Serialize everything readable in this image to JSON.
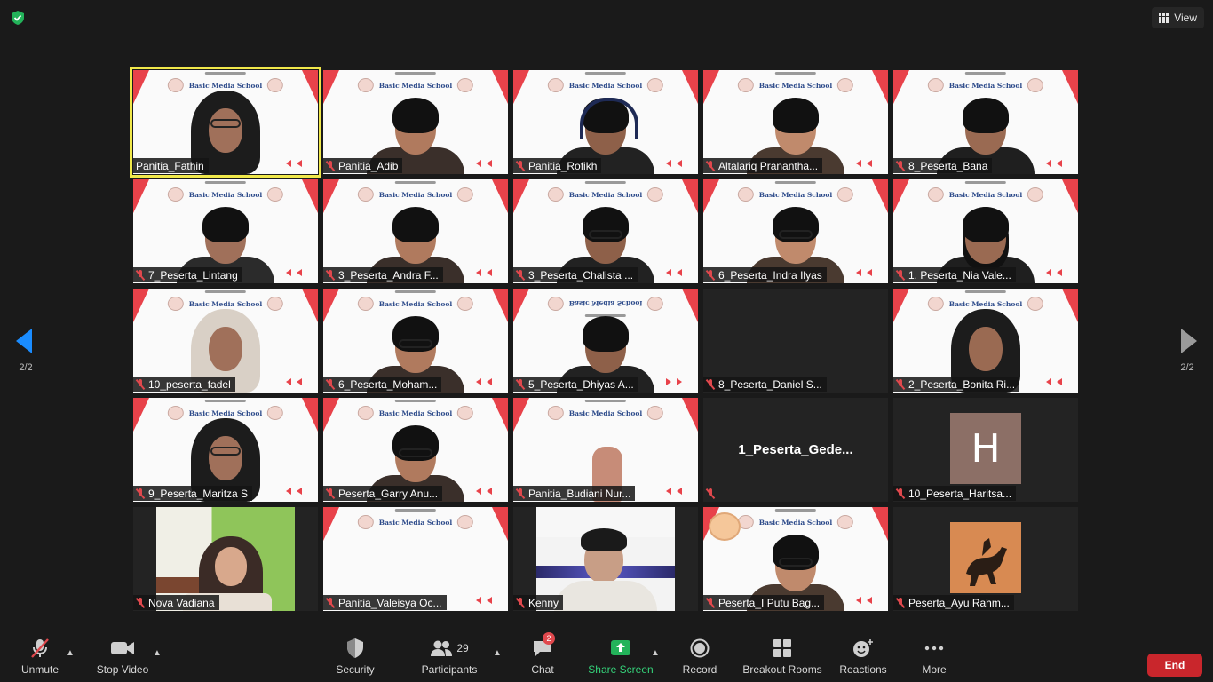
{
  "topbar": {
    "view_label": "View"
  },
  "pagination": {
    "left_page": "2/2",
    "right_page": "2/2"
  },
  "slide_text": "Basic Media School",
  "participants": [
    {
      "name": "Panitia_Fathin",
      "muted": false,
      "kind": "video",
      "active": true,
      "look": "hijab"
    },
    {
      "name": "Panitia_Adib",
      "muted": true,
      "kind": "video",
      "look": "man"
    },
    {
      "name": "Panitia_Rofikh",
      "muted": true,
      "kind": "video",
      "look": "headset"
    },
    {
      "name": "Altalariq Pranantha...",
      "muted": true,
      "kind": "video",
      "look": "man"
    },
    {
      "name": "8_Peserta_Bana",
      "muted": true,
      "kind": "video",
      "look": "man"
    },
    {
      "name": "7_Peserta_Lintang",
      "muted": true,
      "kind": "video",
      "look": "man-low"
    },
    {
      "name": "3_Peserta_Andra F...",
      "muted": true,
      "kind": "video",
      "look": "man"
    },
    {
      "name": "3_Peserta_Chalista ...",
      "muted": true,
      "kind": "video",
      "look": "glasses"
    },
    {
      "name": "6_Peserta_Indra Ilyas",
      "muted": true,
      "kind": "video",
      "look": "glasses"
    },
    {
      "name": "1. Peserta_Nia Vale...",
      "muted": true,
      "kind": "video",
      "look": "hair-long"
    },
    {
      "name": "10_peserta_fadel",
      "muted": true,
      "kind": "video",
      "look": "hijab-light"
    },
    {
      "name": "6_Peserta_Moham...",
      "muted": true,
      "kind": "video",
      "look": "glasses"
    },
    {
      "name": "5_Peserta_Dhiyas A...",
      "muted": true,
      "kind": "video",
      "look": "mirror"
    },
    {
      "name": "8_Peserta_Daniel S...",
      "muted": true,
      "kind": "blank"
    },
    {
      "name": "2_Peserta_Bonita Ri...",
      "muted": true,
      "kind": "video",
      "look": "hijab"
    },
    {
      "name": "9_Peserta_Maritza S",
      "muted": true,
      "kind": "video",
      "look": "hijab-glasses"
    },
    {
      "name": "Peserta_Garry Anu...",
      "muted": true,
      "kind": "video",
      "look": "glasses"
    },
    {
      "name": "Panitia_Budiani Nur...",
      "muted": true,
      "kind": "video",
      "look": "hand"
    },
    {
      "name": "1_Peserta_Gede...",
      "muted": true,
      "kind": "name-only"
    },
    {
      "name": "10_Peserta_Haritsa...",
      "muted": true,
      "kind": "avatar",
      "initial": "H"
    },
    {
      "name": "Nova Vadiana",
      "muted": true,
      "kind": "room",
      "look": "hijab"
    },
    {
      "name": "Panitia_Valeisya Oc...",
      "muted": true,
      "kind": "video",
      "look": "none"
    },
    {
      "name": "Kenny",
      "muted": true,
      "kind": "dark",
      "look": "man"
    },
    {
      "name": "Peserta_I Putu Bag...",
      "muted": true,
      "kind": "video",
      "look": "clap"
    },
    {
      "name": "Peserta_Ayu Rahm...",
      "muted": true,
      "kind": "horse"
    }
  ],
  "toolbar": {
    "unmute": "Unmute",
    "stop_video": "Stop Video",
    "security": "Security",
    "participants": "Participants",
    "participants_count": "29",
    "chat": "Chat",
    "chat_badge": "2",
    "share_screen": "Share Screen",
    "record": "Record",
    "breakout_rooms": "Breakout Rooms",
    "reactions": "Reactions",
    "more": "More",
    "end": "End"
  },
  "colors": {
    "accent_blue": "#1a8cff",
    "share_green": "#35d37a",
    "end_red": "#c9262c",
    "active_outline": "#f0e84a"
  }
}
